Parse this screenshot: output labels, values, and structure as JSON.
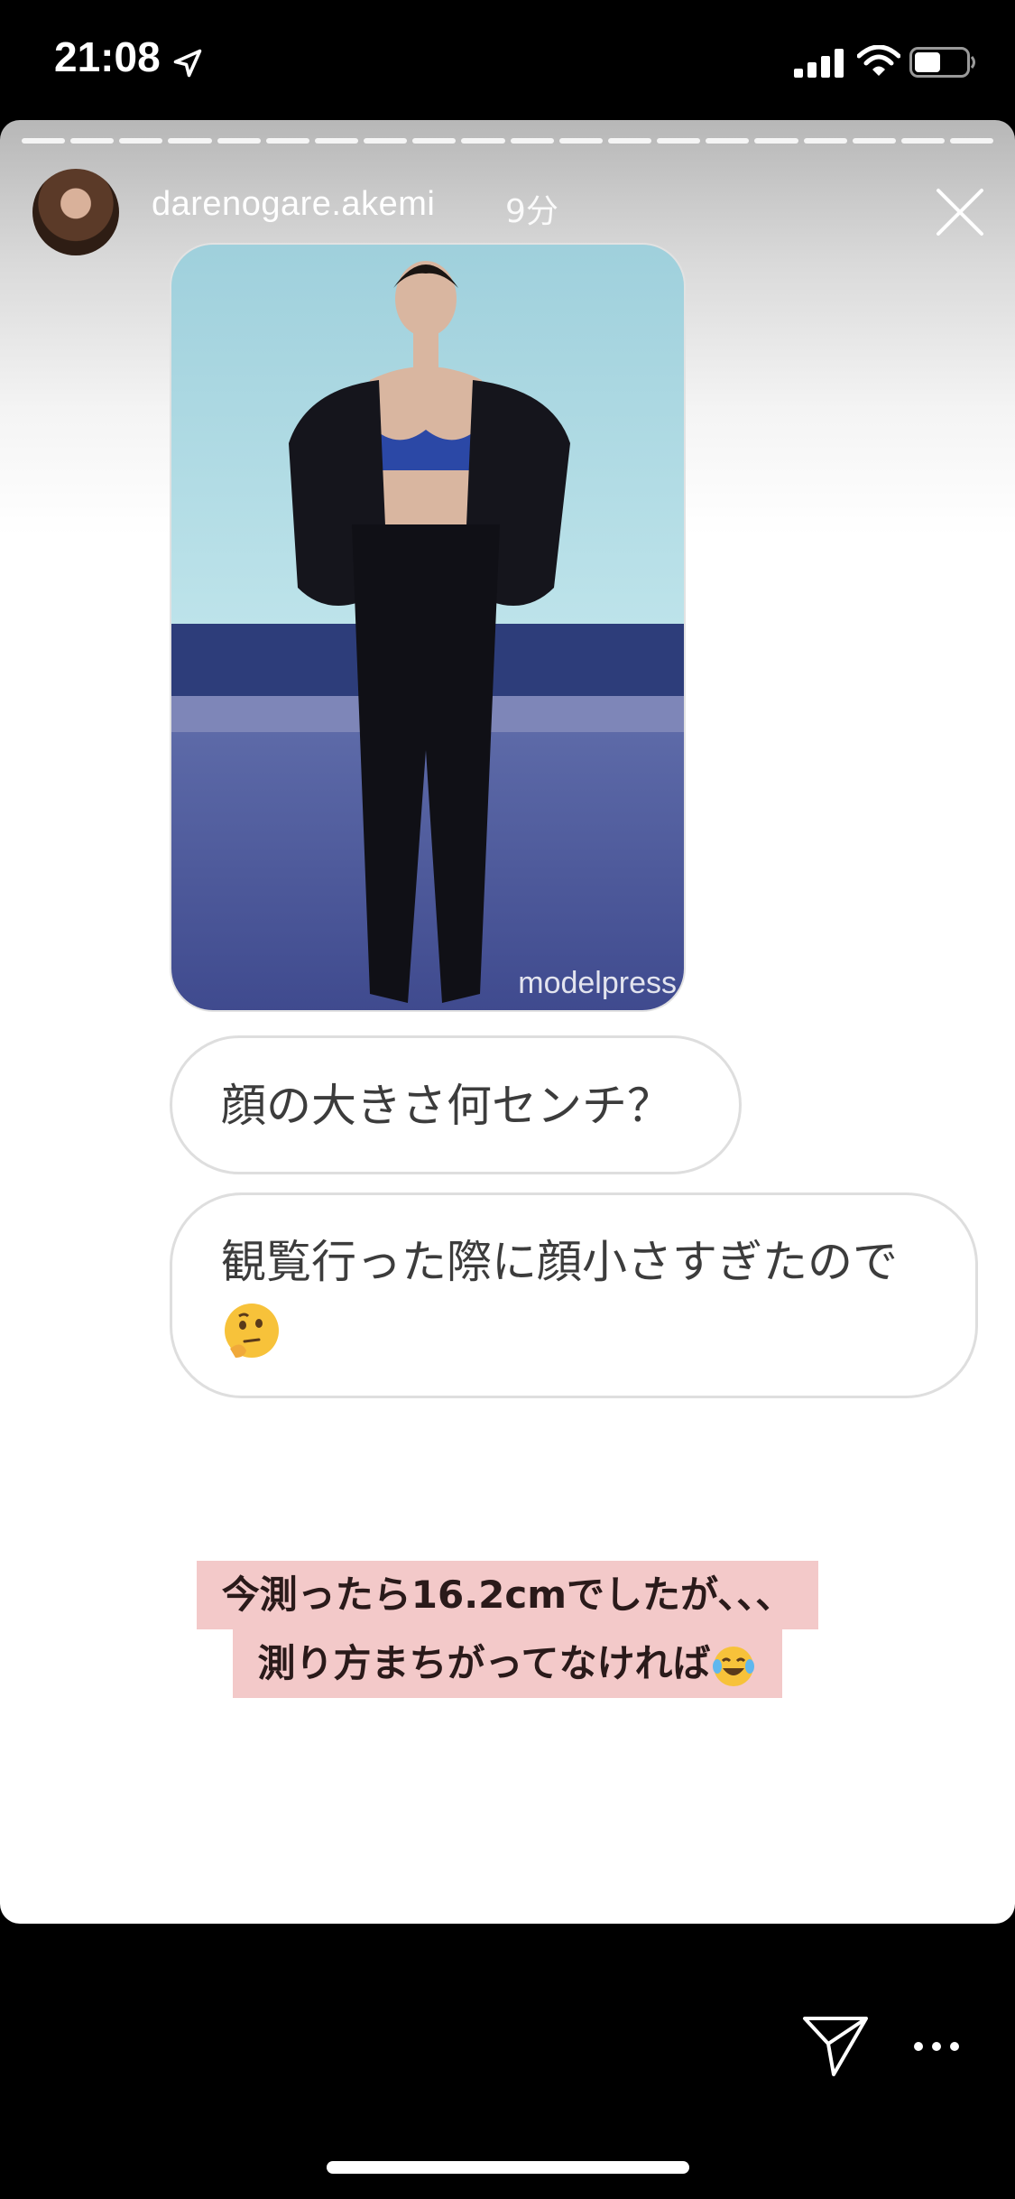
{
  "status_bar": {
    "time": "21:08"
  },
  "story": {
    "username": "darenogare.akemi",
    "time_ago": "9分",
    "progress_segments": 20
  },
  "photo": {
    "watermark": "modelpress"
  },
  "questions": [
    {
      "text": "顔の大きさ何センチ？"
    },
    {
      "text": "観覧行った際に顔小さすぎたので"
    }
  ],
  "answer": {
    "line1": "今測ったら16.2cmでしたが、、、",
    "line2": "測り方まちがってなければ"
  },
  "icons": {
    "close": "close-icon",
    "send": "send-icon",
    "more": "more-icon",
    "thinking_emoji": "thinking-face-emoji",
    "laugh_emoji": "tears-of-joy-emoji"
  },
  "colors": {
    "highlight": "#f3c9c9",
    "bubble_border": "#dedede"
  }
}
